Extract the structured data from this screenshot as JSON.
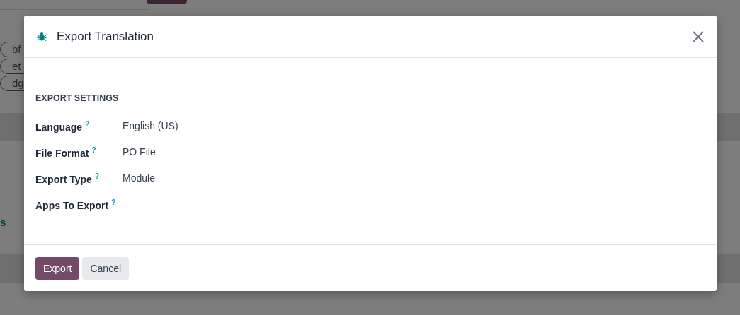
{
  "background": {
    "tags": [
      "bf",
      "et",
      "dg"
    ],
    "link_fragment": "s"
  },
  "dialog": {
    "title": "Export Translation",
    "section_title": "EXPORT SETTINGS",
    "fields": [
      {
        "label": "Language",
        "help": "?",
        "value": "English (US)"
      },
      {
        "label": "File Format",
        "help": "?",
        "value": "PO File"
      },
      {
        "label": "Export Type",
        "help": "?",
        "value": "Module"
      },
      {
        "label": "Apps To Export",
        "help": "?"
      }
    ],
    "buttons": [
      {
        "label": "Export",
        "kind": "primary"
      },
      {
        "label": "Cancel",
        "kind": "secondary"
      }
    ]
  }
}
